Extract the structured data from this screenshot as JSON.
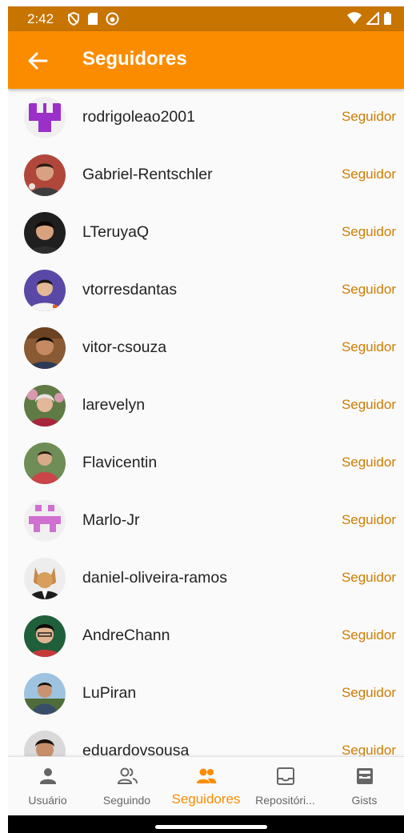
{
  "status": {
    "time": "2:42"
  },
  "appbar": {
    "title": "Seguidores"
  },
  "followers": [
    {
      "username": "rodrigoleao2001",
      "role": "Seguidor",
      "avatar": "identicon-purple"
    },
    {
      "username": "Gabriel-Rentschler",
      "role": "Seguidor",
      "avatar": "photo"
    },
    {
      "username": "LTeruyaQ",
      "role": "Seguidor",
      "avatar": "photo"
    },
    {
      "username": "vtorresdantas",
      "role": "Seguidor",
      "avatar": "photo"
    },
    {
      "username": "vitor-csouza",
      "role": "Seguidor",
      "avatar": "photo"
    },
    {
      "username": "larevelyn",
      "role": "Seguidor",
      "avatar": "photo"
    },
    {
      "username": "Flavicentin",
      "role": "Seguidor",
      "avatar": "photo"
    },
    {
      "username": "Marlo-Jr",
      "role": "Seguidor",
      "avatar": "identicon-pink"
    },
    {
      "username": "daniel-oliveira-ramos",
      "role": "Seguidor",
      "avatar": "photo"
    },
    {
      "username": "AndreChann",
      "role": "Seguidor",
      "avatar": "photo"
    },
    {
      "username": "LuPiran",
      "role": "Seguidor",
      "avatar": "photo"
    },
    {
      "username": "eduardovsousa",
      "role": "Seguidor",
      "avatar": "photo"
    }
  ],
  "bottom_nav": {
    "active": "Seguidores",
    "tabs": [
      {
        "label": "Usuário",
        "icon": "person-icon"
      },
      {
        "label": "Seguindo",
        "icon": "people-outline-icon"
      },
      {
        "label": "Seguidores",
        "icon": "people-icon"
      },
      {
        "label": "Repositóri...",
        "icon": "inbox-icon"
      },
      {
        "label": "Gists",
        "icon": "archive-icon"
      }
    ]
  },
  "colors": {
    "primary": "#fb8c00",
    "status_bar": "#c87400",
    "role_text": "#d07c00",
    "background": "#fafafa"
  }
}
